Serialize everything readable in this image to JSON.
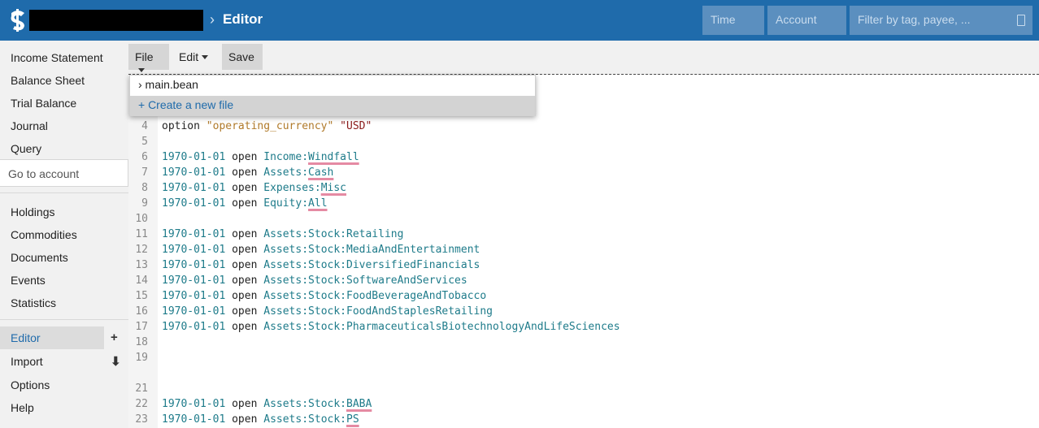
{
  "header": {
    "breadcrumb_sep": "›",
    "title": "Editor",
    "time_placeholder": "Time",
    "account_placeholder": "Account",
    "filter_placeholder": "Filter by tag, payee, ..."
  },
  "sidebar": {
    "reports": [
      "Income Statement",
      "Balance Sheet",
      "Trial Balance",
      "Journal",
      "Query"
    ],
    "goto_placeholder": "Go to account",
    "secondary": [
      "Holdings",
      "Commodities",
      "Documents",
      "Events",
      "Statistics"
    ],
    "tertiary": [
      {
        "label": "Editor",
        "icon": "plus-icon",
        "glyph": "+"
      },
      {
        "label": "Import",
        "icon": "download-icon",
        "glyph": "⬇"
      },
      {
        "label": "Options"
      },
      {
        "label": "Help"
      }
    ]
  },
  "toolbar": {
    "file_label": "File",
    "edit_label": "Edit",
    "save_label": "Save"
  },
  "dropdown": {
    "file_item": "› main.bean",
    "create_item": "+ Create a new file"
  },
  "editor": {
    "lines": [
      {
        "n": "4",
        "type": "option",
        "kw": "option",
        "key": "\"operating_currency\"",
        "val": "\"USD\""
      },
      {
        "n": "5",
        "type": "blank"
      },
      {
        "n": "6",
        "type": "open",
        "date": "1970-01-01",
        "kw": "open",
        "acct_a": "Income:",
        "acct_b": "Windfall",
        "err": true
      },
      {
        "n": "7",
        "type": "open",
        "date": "1970-01-01",
        "kw": "open",
        "acct_a": "Assets:",
        "acct_b": "Cash",
        "err": true
      },
      {
        "n": "8",
        "type": "open",
        "date": "1970-01-01",
        "kw": "open",
        "acct_a": "Expenses:",
        "acct_b": "Misc",
        "err": true
      },
      {
        "n": "9",
        "type": "open",
        "date": "1970-01-01",
        "kw": "open",
        "acct_a": "Equity:",
        "acct_b": "All",
        "err": true
      },
      {
        "n": "10",
        "type": "blank"
      },
      {
        "n": "11",
        "type": "open",
        "date": "1970-01-01",
        "kw": "open",
        "acct_a": "Assets:Stock:Retailing",
        "acct_b": ""
      },
      {
        "n": "12",
        "type": "open",
        "date": "1970-01-01",
        "kw": "open",
        "acct_a": "Assets:Stock:MediaAndEntertainment",
        "acct_b": ""
      },
      {
        "n": "13",
        "type": "open",
        "date": "1970-01-01",
        "kw": "open",
        "acct_a": "Assets:Stock:DiversifiedFinancials",
        "acct_b": ""
      },
      {
        "n": "14",
        "type": "open",
        "date": "1970-01-01",
        "kw": "open",
        "acct_a": "Assets:Stock:SoftwareAndServices",
        "acct_b": ""
      },
      {
        "n": "15",
        "type": "open",
        "date": "1970-01-01",
        "kw": "open",
        "acct_a": "Assets:Stock:FoodBeverageAndTobacco",
        "acct_b": ""
      },
      {
        "n": "16",
        "type": "open",
        "date": "1970-01-01",
        "kw": "open",
        "acct_a": "Assets:Stock:FoodAndStaplesRetailing",
        "acct_b": ""
      },
      {
        "n": "17",
        "type": "open",
        "date": "1970-01-01",
        "kw": "open",
        "acct_a": "Assets:Stock:PharmaceuticalsBiotechnologyAndLifeSciences",
        "acct_b": ""
      },
      {
        "n": "18",
        "type": "blank"
      },
      {
        "n": "19",
        "type": "blank"
      },
      {
        "n": "",
        "type": "blank"
      },
      {
        "n": "21",
        "type": "blank"
      },
      {
        "n": "22",
        "type": "open",
        "date": "1970-01-01",
        "kw": "open",
        "acct_a": "Assets:Stock:",
        "acct_b": "BABA",
        "err": true
      },
      {
        "n": "23",
        "type": "open",
        "date": "1970-01-01",
        "kw": "open",
        "acct_a": "Assets:Stock:",
        "acct_b": "PS",
        "err": true
      }
    ]
  },
  "colors": {
    "header": "#1f6bab",
    "accent": "#1f6bab",
    "error_underline": "#e58aa3",
    "account": "#1e7b8a"
  }
}
